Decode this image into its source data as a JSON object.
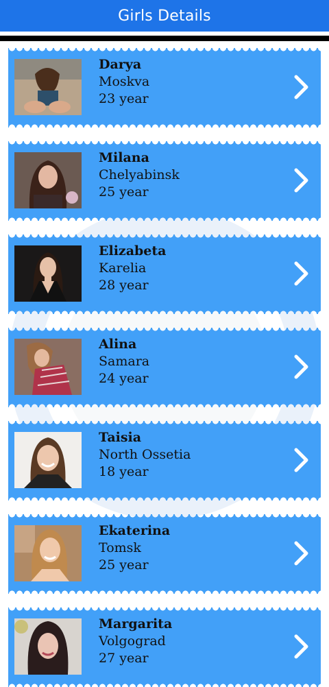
{
  "header": {
    "title": "Girls Details"
  },
  "colors": {
    "appbar": "#1e74e8",
    "card": "#42a0f8",
    "text": "#111111"
  },
  "icons": {
    "row_action": "chevron-right-icon"
  },
  "profiles": [
    {
      "name": "Darya",
      "city": "Moskva",
      "age": "23 year"
    },
    {
      "name": "Milana",
      "city": "Chelyabinsk",
      "age": "25 year"
    },
    {
      "name": "Elizabeta",
      "city": "Karelia",
      "age": "28 year"
    },
    {
      "name": "Alina",
      "city": "Samara",
      "age": "24 year"
    },
    {
      "name": "Taisia",
      "city": "North Ossetia",
      "age": "18 year"
    },
    {
      "name": "Ekaterina",
      "city": "Tomsk",
      "age": "25 year"
    },
    {
      "name": "Margarita",
      "city": "Volgograd",
      "age": "27 year"
    }
  ]
}
